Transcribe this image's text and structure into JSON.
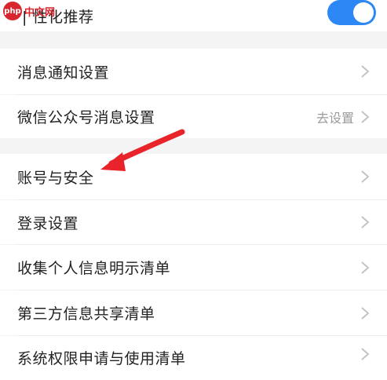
{
  "watermark": {
    "badge": "php",
    "text": "中文网"
  },
  "personalized": {
    "label": "| 性化推荐",
    "toggle_on": true
  },
  "settings": {
    "notifications": "消息通知设置",
    "wechat_official": "微信公众号消息设置",
    "wechat_action": "去设置",
    "account_security": "账号与安全",
    "login_settings": "登录设置",
    "personal_info_list": "收集个人信息明示清单",
    "third_party_list": "第三方信息共享清单",
    "permission_list": "系统权限申请与使用清单"
  },
  "colors": {
    "toggle": "#2d88f5",
    "arrow": "#e8232a",
    "background": "#f4f4f4"
  },
  "icons": {
    "chevron": "chevron-right-icon",
    "arrow": "red-arrow-annotation"
  }
}
